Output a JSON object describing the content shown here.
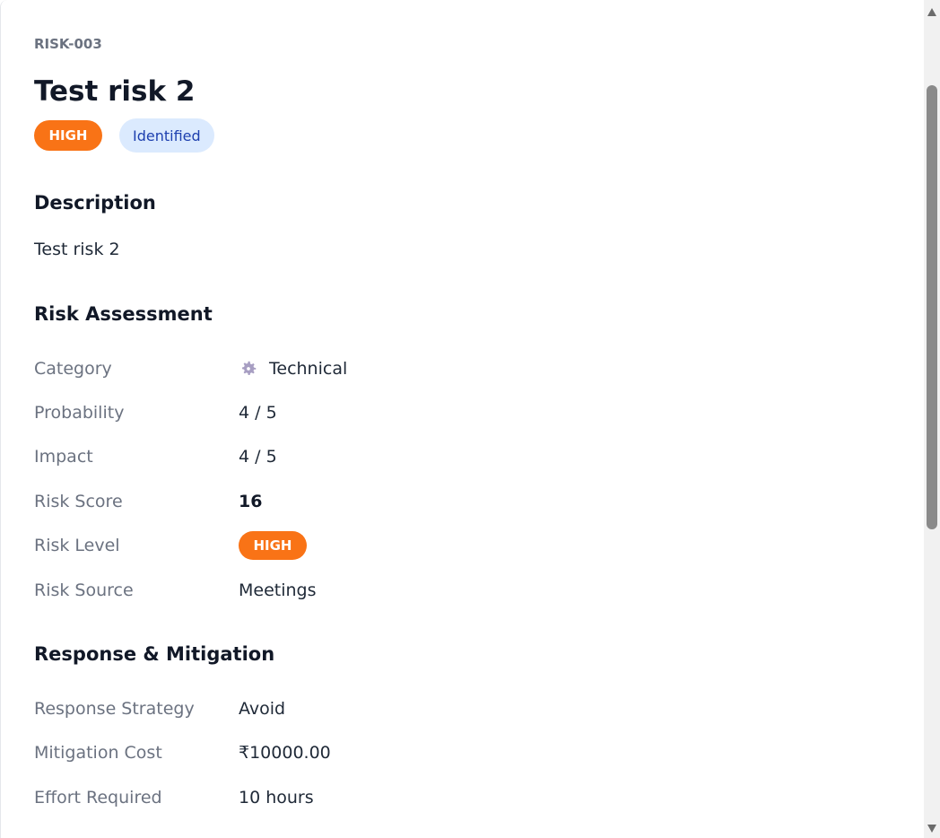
{
  "risk": {
    "id": "RISK-003",
    "title": "Test risk 2",
    "priority_badge": "HIGH",
    "status_badge": "Identified"
  },
  "description": {
    "heading": "Description",
    "text": "Test risk 2"
  },
  "assessment": {
    "heading": "Risk Assessment",
    "category": {
      "label": "Category",
      "value": "Technical",
      "icon": "gear-icon"
    },
    "probability": {
      "label": "Probability",
      "value": "4 / 5"
    },
    "impact": {
      "label": "Impact",
      "value": "4 / 5"
    },
    "score": {
      "label": "Risk Score",
      "value": "16"
    },
    "level": {
      "label": "Risk Level",
      "value": "HIGH"
    },
    "source": {
      "label": "Risk Source",
      "value": "Meetings"
    }
  },
  "response": {
    "heading": "Response & Mitigation",
    "strategy": {
      "label": "Response Strategy",
      "value": "Avoid"
    },
    "cost": {
      "label": "Mitigation Cost",
      "value": "₹10000.00"
    },
    "effort": {
      "label": "Effort Required",
      "value": "10 hours"
    }
  },
  "colors": {
    "high": "#f97316",
    "status_bg": "#dbeafe",
    "status_text": "#1e40af"
  }
}
